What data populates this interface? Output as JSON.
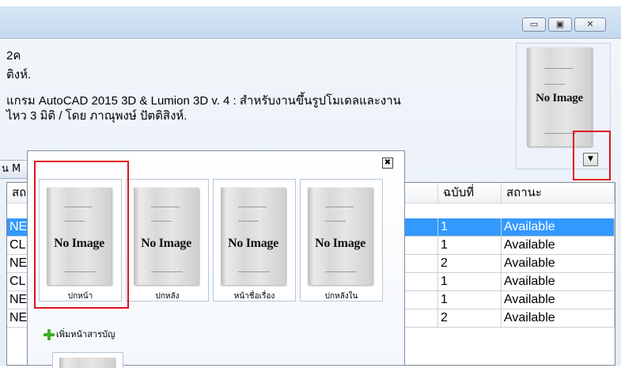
{
  "window": {
    "title_buttons": [
      {
        "name": "minimize",
        "glyph": "▭"
      },
      {
        "name": "maximize",
        "glyph": "▣"
      },
      {
        "name": "close",
        "glyph": "✕"
      }
    ]
  },
  "record": {
    "line1": "2ค",
    "line2": "ติงห์.",
    "line3": "แกรม AutoCAD 2015 3D & Lumion 3D v. 4 :  สำหรับงานขึ้นรูปโมเดลและงาน",
    "line4": "ไหว 3 มิติ /  โดย ภาณุพงษ์ ปัตติสิงห์."
  },
  "cover_image": {
    "text": "No Image",
    "dropdown_glyph": "▼"
  },
  "tab": {
    "label": "น M"
  },
  "grid": {
    "headers": [
      "สถ",
      "ฉบับที่",
      "สถานะ"
    ],
    "rows": [
      {
        "code": "NE",
        "copy": "1",
        "status": "Available",
        "selected": true
      },
      {
        "code": "CL",
        "copy": "1",
        "status": "Available",
        "selected": false
      },
      {
        "code": "NE",
        "copy": "2",
        "status": "Available",
        "selected": false
      },
      {
        "code": "CL",
        "copy": "1",
        "status": "Available",
        "selected": false
      },
      {
        "code": "NE",
        "copy": "1",
        "status": "Available",
        "selected": false
      },
      {
        "code": "NE",
        "copy": "2",
        "status": "Available",
        "selected": false
      }
    ]
  },
  "popup": {
    "close_glyph": "✖",
    "cards": [
      {
        "image_text": "No Image",
        "label": "ปกหน้า"
      },
      {
        "image_text": "No Image",
        "label": "ปกหลัง"
      },
      {
        "image_text": "No Image",
        "label": "หน้าชื่อเรื่อง"
      },
      {
        "image_text": "No Image",
        "label": "ปกหลังใน"
      }
    ],
    "add_link": "เพิ่มหน้าสารบัญ"
  },
  "colors": {
    "selection": "#3399ff",
    "highlight": "#e0141e",
    "add_icon": "#3fae29"
  }
}
